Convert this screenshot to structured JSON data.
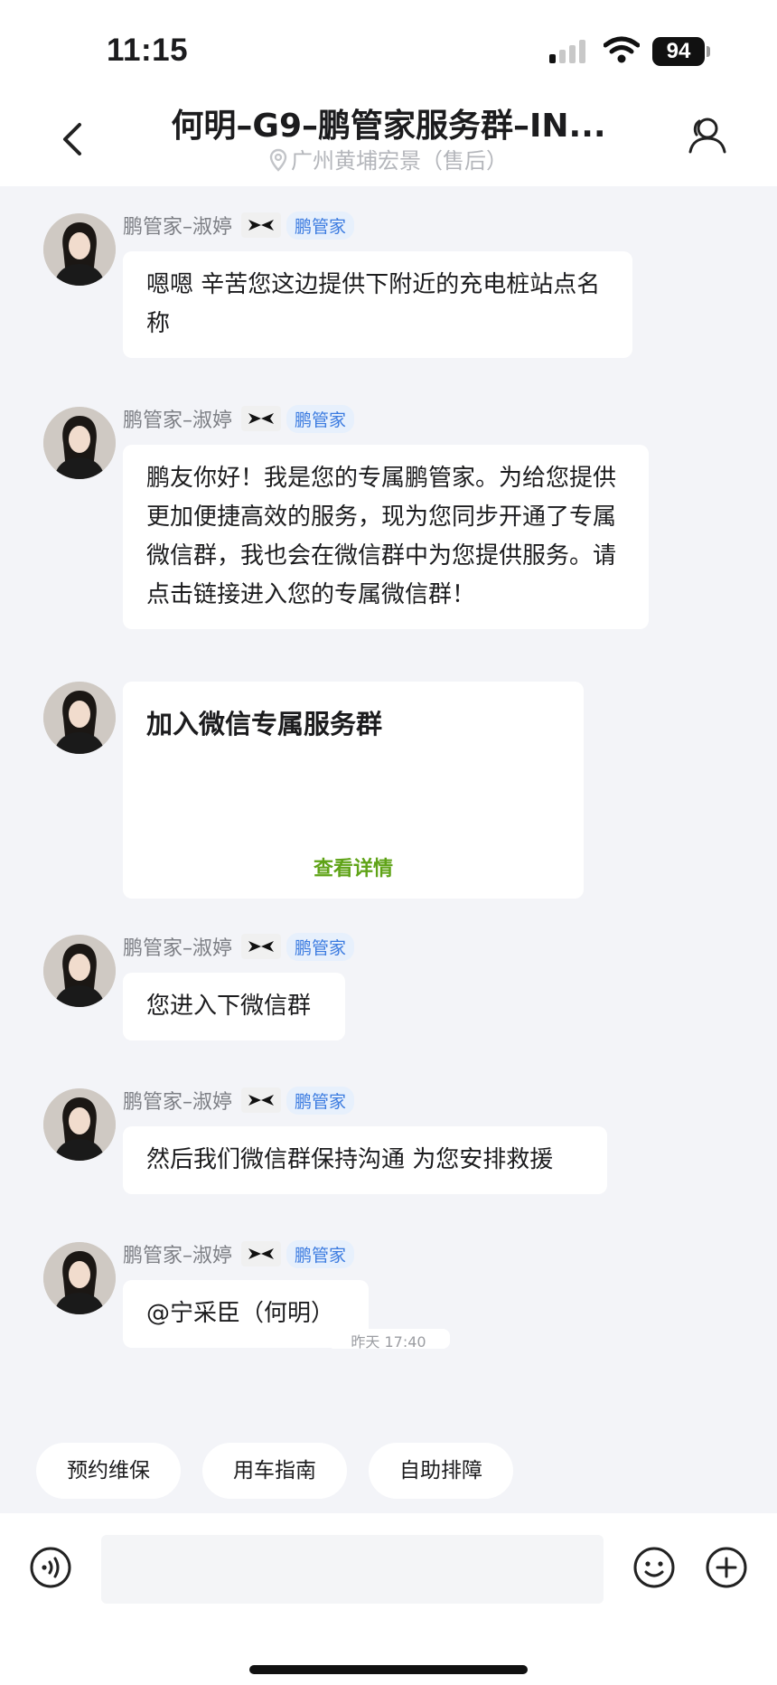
{
  "status_bar": {
    "time": "11:15",
    "battery": "94"
  },
  "header": {
    "title": "何明–G9–鹏管家服务群–IN...",
    "subtitle": "广州黄埔宏景（售后）"
  },
  "agent": {
    "name": "鹏管家–淑婷",
    "badge": "鹏管家"
  },
  "messages": [
    {
      "text": "嗯嗯 辛苦您这边提供下附近的充电桩站点名称"
    },
    {
      "text": "鹏友你好！我是您的专属鹏管家。为给您提供更加便捷高效的服务，现为您同步开通了专属微信群，我也会在微信群中为您提供服务。请点击链接进入您的专属微信群！"
    },
    {
      "card_title": "加入微信专属服务群",
      "card_link": "查看详情"
    },
    {
      "text": "您进入下微信群"
    },
    {
      "text": "然后我们微信群保持沟通 为您安排救援"
    },
    {
      "text": "@宁采臣（何明）"
    }
  ],
  "timestamp": "昨天 17:40",
  "quick_actions": [
    "预约维保",
    "用车指南",
    "自助排障"
  ],
  "input": {
    "value": ""
  },
  "colors": {
    "accent": "#3b7be0",
    "link_green": "#5fa317",
    "background": "#f3f4f8"
  }
}
